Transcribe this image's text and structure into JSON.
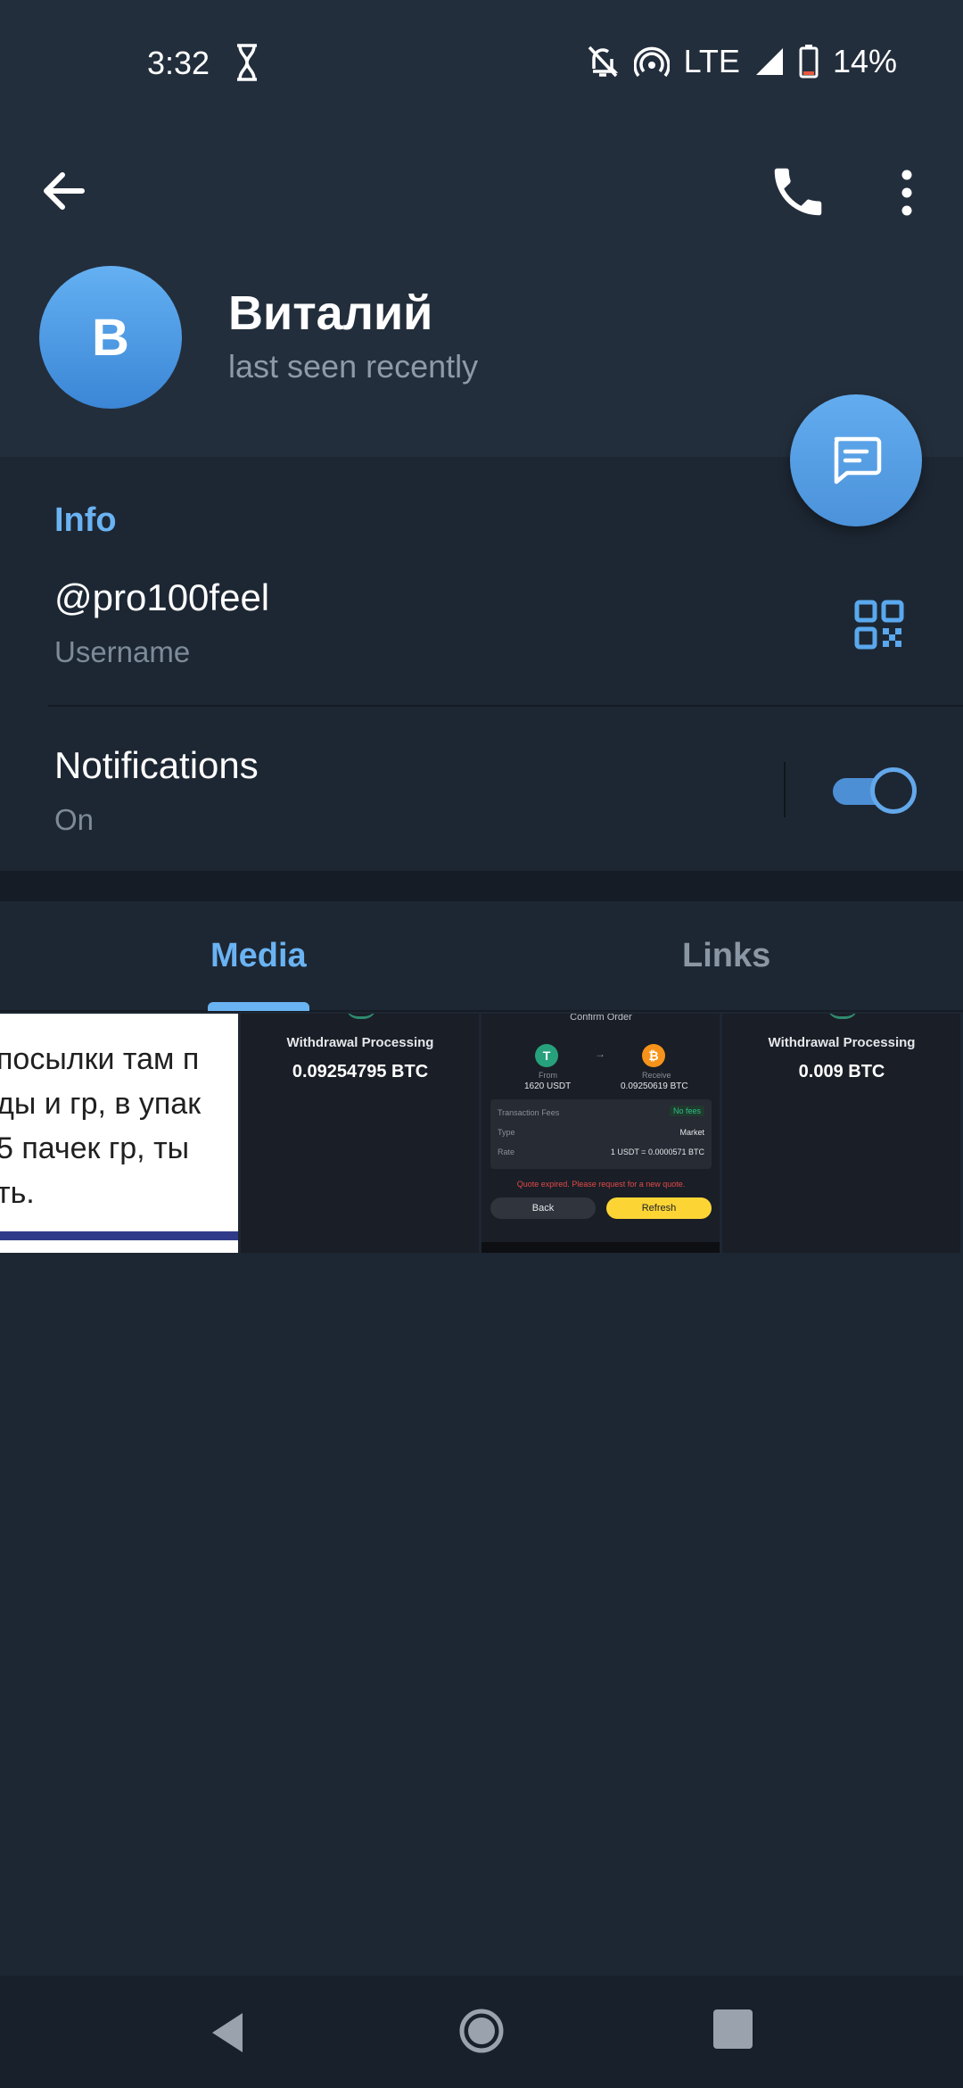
{
  "status_bar": {
    "time": "3:32",
    "network": "LTE",
    "battery": "14%",
    "icons": [
      "hourglass-icon",
      "bell-off-icon",
      "hotspot-icon",
      "signal-icon",
      "battery-icon"
    ]
  },
  "toolbar": {
    "icons": [
      "back-arrow-icon",
      "phone-icon",
      "more-vertical-icon"
    ]
  },
  "profile": {
    "avatar_letter": "В",
    "name": "Виталий",
    "status": "last seen recently"
  },
  "fab": {
    "icon": "message-icon"
  },
  "info": {
    "heading": "Info",
    "username": "@pro100feel",
    "username_label": "Username",
    "qr_icon": "qr-code-icon",
    "notifications_label": "Notifications",
    "notifications_value": "On",
    "notifications_enabled": true
  },
  "tabs": [
    {
      "label": "Media",
      "active": true
    },
    {
      "label": "Links",
      "active": false
    }
  ],
  "media": {
    "thumb1_text": "посылки там п\nды и гр, в упак\n5 пачек гр, ты\nть.",
    "thumb2_label": "Withdrawal Processing",
    "thumb2_value": "0.09254795 BTC",
    "thumb3": {
      "title": "Confirm Order",
      "from_label": "From",
      "from_value": "1620 USDT",
      "to_label": "Receive",
      "to_value": "0.09250619 BTC",
      "fees_label": "Transaction Fees",
      "fees_value": "No fees",
      "type_label": "Type",
      "type_value": "Market",
      "rate_label": "Rate",
      "rate_value": "1 USDT = 0.0000571 BTC",
      "expired_text": "Quote expired. Please request for a new quote.",
      "back_label": "Back",
      "refresh_label": "Refresh"
    },
    "thumb4_label": "Withdrawal Processing",
    "thumb4_value": "0.009 BTC"
  },
  "colors": {
    "header_bg": "#232e3c",
    "body_bg": "#1d2733",
    "accent": "#6ab3f3",
    "secondary_text": "#7d8b99"
  },
  "nav_bar": {
    "icons": [
      "nav-back-icon",
      "nav-home-icon",
      "nav-recents-icon"
    ]
  }
}
